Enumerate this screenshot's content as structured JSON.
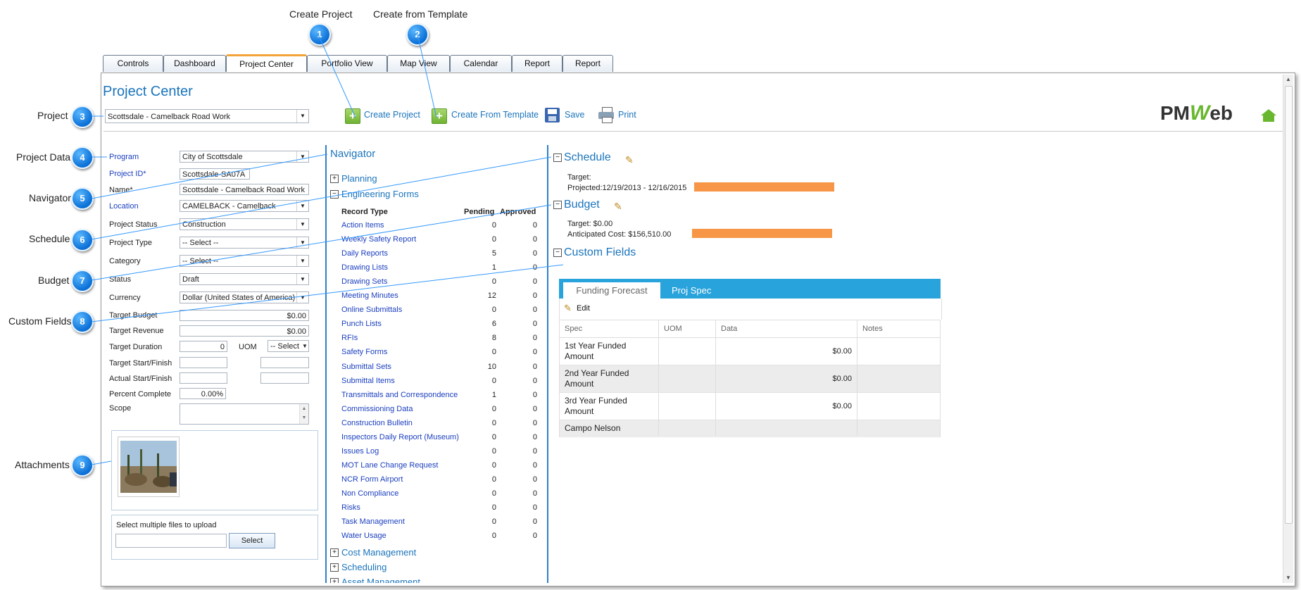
{
  "callouts": {
    "create_project": "Create Project",
    "create_from_template": "Create from Template",
    "project": "Project",
    "project_data": "Project Data",
    "navigator": "Navigator",
    "schedule": "Schedule",
    "budget": "Budget",
    "custom_fields": "Custom Fields",
    "attachments": "Attachments",
    "numbers": [
      "1",
      "2",
      "3",
      "4",
      "5",
      "6",
      "7",
      "8",
      "9"
    ]
  },
  "tabs": [
    "Controls",
    "Dashboard",
    "Project Center",
    "Portfolio View",
    "Map View",
    "Calendar",
    "Report",
    "Report"
  ],
  "active_tab": "Project Center",
  "page_title": "Project Center",
  "toolbar": {
    "project_value": "Scottsdale - Camelback Road Work",
    "create_project": "Create Project",
    "create_from_template": "Create From Template",
    "save": "Save",
    "print": "Print"
  },
  "logo": {
    "text_pm": "PM",
    "text_w": "W",
    "text_eb": "eb"
  },
  "form": {
    "program_label": "Program",
    "program_value": "City of Scottsdale",
    "project_id_label": "Project ID*",
    "project_id_value": "Scottsdale-SA07A",
    "name_label": "Name*",
    "name_value": "Scottsdale - Camelback Road Work",
    "location_label": "Location",
    "location_value": "CAMELBACK - Camelback",
    "project_status_label": "Project Status",
    "project_status_value": "Construction",
    "project_type_label": "Project Type",
    "project_type_value": "-- Select --",
    "category_label": "Category",
    "category_value": "-- Select --",
    "status_label": "Status",
    "status_value": "Draft",
    "currency_label": "Currency",
    "currency_value": "Dollar (United States of America)",
    "target_budget_label": "Target Budget",
    "target_budget_value": "$0.00",
    "target_revenue_label": "Target Revenue",
    "target_revenue_value": "$0.00",
    "target_duration_label": "Target Duration",
    "target_duration_value": "0",
    "uom_label": "UOM",
    "uom_value": "-- Select",
    "target_start_finish_label": "Target Start/Finish",
    "actual_start_finish_label": "Actual Start/Finish",
    "percent_complete_label": "Percent Complete",
    "percent_complete_value": "0.00%",
    "scope_label": "Scope",
    "upload_label": "Select multiple files to upload",
    "select_button": "Select"
  },
  "navigator": {
    "title": "Navigator",
    "sections_top": [
      "Planning",
      "Engineering Forms"
    ],
    "sections_bottom": [
      "Cost Management",
      "Scheduling",
      "Asset Management"
    ],
    "col_record_type": "Record Type",
    "col_pending": "Pending",
    "col_approved": "Approved",
    "rows": [
      {
        "name": "Action Items",
        "pending": "0",
        "approved": "0"
      },
      {
        "name": "Weekly Safety Report",
        "pending": "0",
        "approved": "0"
      },
      {
        "name": "Daily Reports",
        "pending": "5",
        "approved": "0"
      },
      {
        "name": "Drawing Lists",
        "pending": "1",
        "approved": "0"
      },
      {
        "name": "Drawing Sets",
        "pending": "0",
        "approved": "0"
      },
      {
        "name": "Meeting Minutes",
        "pending": "12",
        "approved": "0"
      },
      {
        "name": "Online Submittals",
        "pending": "0",
        "approved": "0"
      },
      {
        "name": "Punch Lists",
        "pending": "6",
        "approved": "0"
      },
      {
        "name": "RFIs",
        "pending": "8",
        "approved": "0"
      },
      {
        "name": "Safety Forms",
        "pending": "0",
        "approved": "0"
      },
      {
        "name": "Submittal Sets",
        "pending": "10",
        "approved": "0"
      },
      {
        "name": "Submittal Items",
        "pending": "0",
        "approved": "0"
      },
      {
        "name": "Transmittals and Correspondence",
        "pending": "1",
        "approved": "0"
      },
      {
        "name": "Commissioning Data",
        "pending": "0",
        "approved": "0"
      },
      {
        "name": "Construction Bulletin",
        "pending": "0",
        "approved": "0"
      },
      {
        "name": "Inspectors Daily Report (Museum)",
        "pending": "0",
        "approved": "0"
      },
      {
        "name": "Issues Log",
        "pending": "0",
        "approved": "0"
      },
      {
        "name": "MOT Lane Change Request",
        "pending": "0",
        "approved": "0"
      },
      {
        "name": "NCR Form Airport",
        "pending": "0",
        "approved": "0"
      },
      {
        "name": "Non Compliance",
        "pending": "0",
        "approved": "0"
      },
      {
        "name": "Risks",
        "pending": "0",
        "approved": "0"
      },
      {
        "name": "Task Management",
        "pending": "0",
        "approved": "0"
      },
      {
        "name": "Water Usage",
        "pending": "0",
        "approved": "0"
      }
    ]
  },
  "schedule": {
    "title": "Schedule",
    "target_label": "Target:",
    "projected_label": "Projected:12/19/2013 - 12/16/2015"
  },
  "budget": {
    "title": "Budget",
    "target_label": "Target: $0.00",
    "anticipated_label": "Anticipated Cost: $156,510.00"
  },
  "custom_fields": {
    "title": "Custom Fields",
    "tabs": [
      "Funding Forecast",
      "Proj Spec"
    ],
    "edit_label": "Edit",
    "columns": [
      "Spec",
      "UOM",
      "Data",
      "Notes"
    ],
    "rows": [
      {
        "spec": "1st Year Funded Amount",
        "uom": "",
        "data": "$0.00",
        "notes": ""
      },
      {
        "spec": "2nd Year Funded Amount",
        "uom": "",
        "data": "$0.00",
        "notes": ""
      },
      {
        "spec": "3rd Year Funded Amount",
        "uom": "",
        "data": "$0.00",
        "notes": ""
      },
      {
        "spec": "Campo Nelson",
        "uom": "",
        "data": "",
        "notes": ""
      }
    ]
  },
  "colors": {
    "accent": "#1b75bc",
    "bar": "#f79646",
    "tab_active": "#f2a33a",
    "custom_header": "#29a3db"
  }
}
